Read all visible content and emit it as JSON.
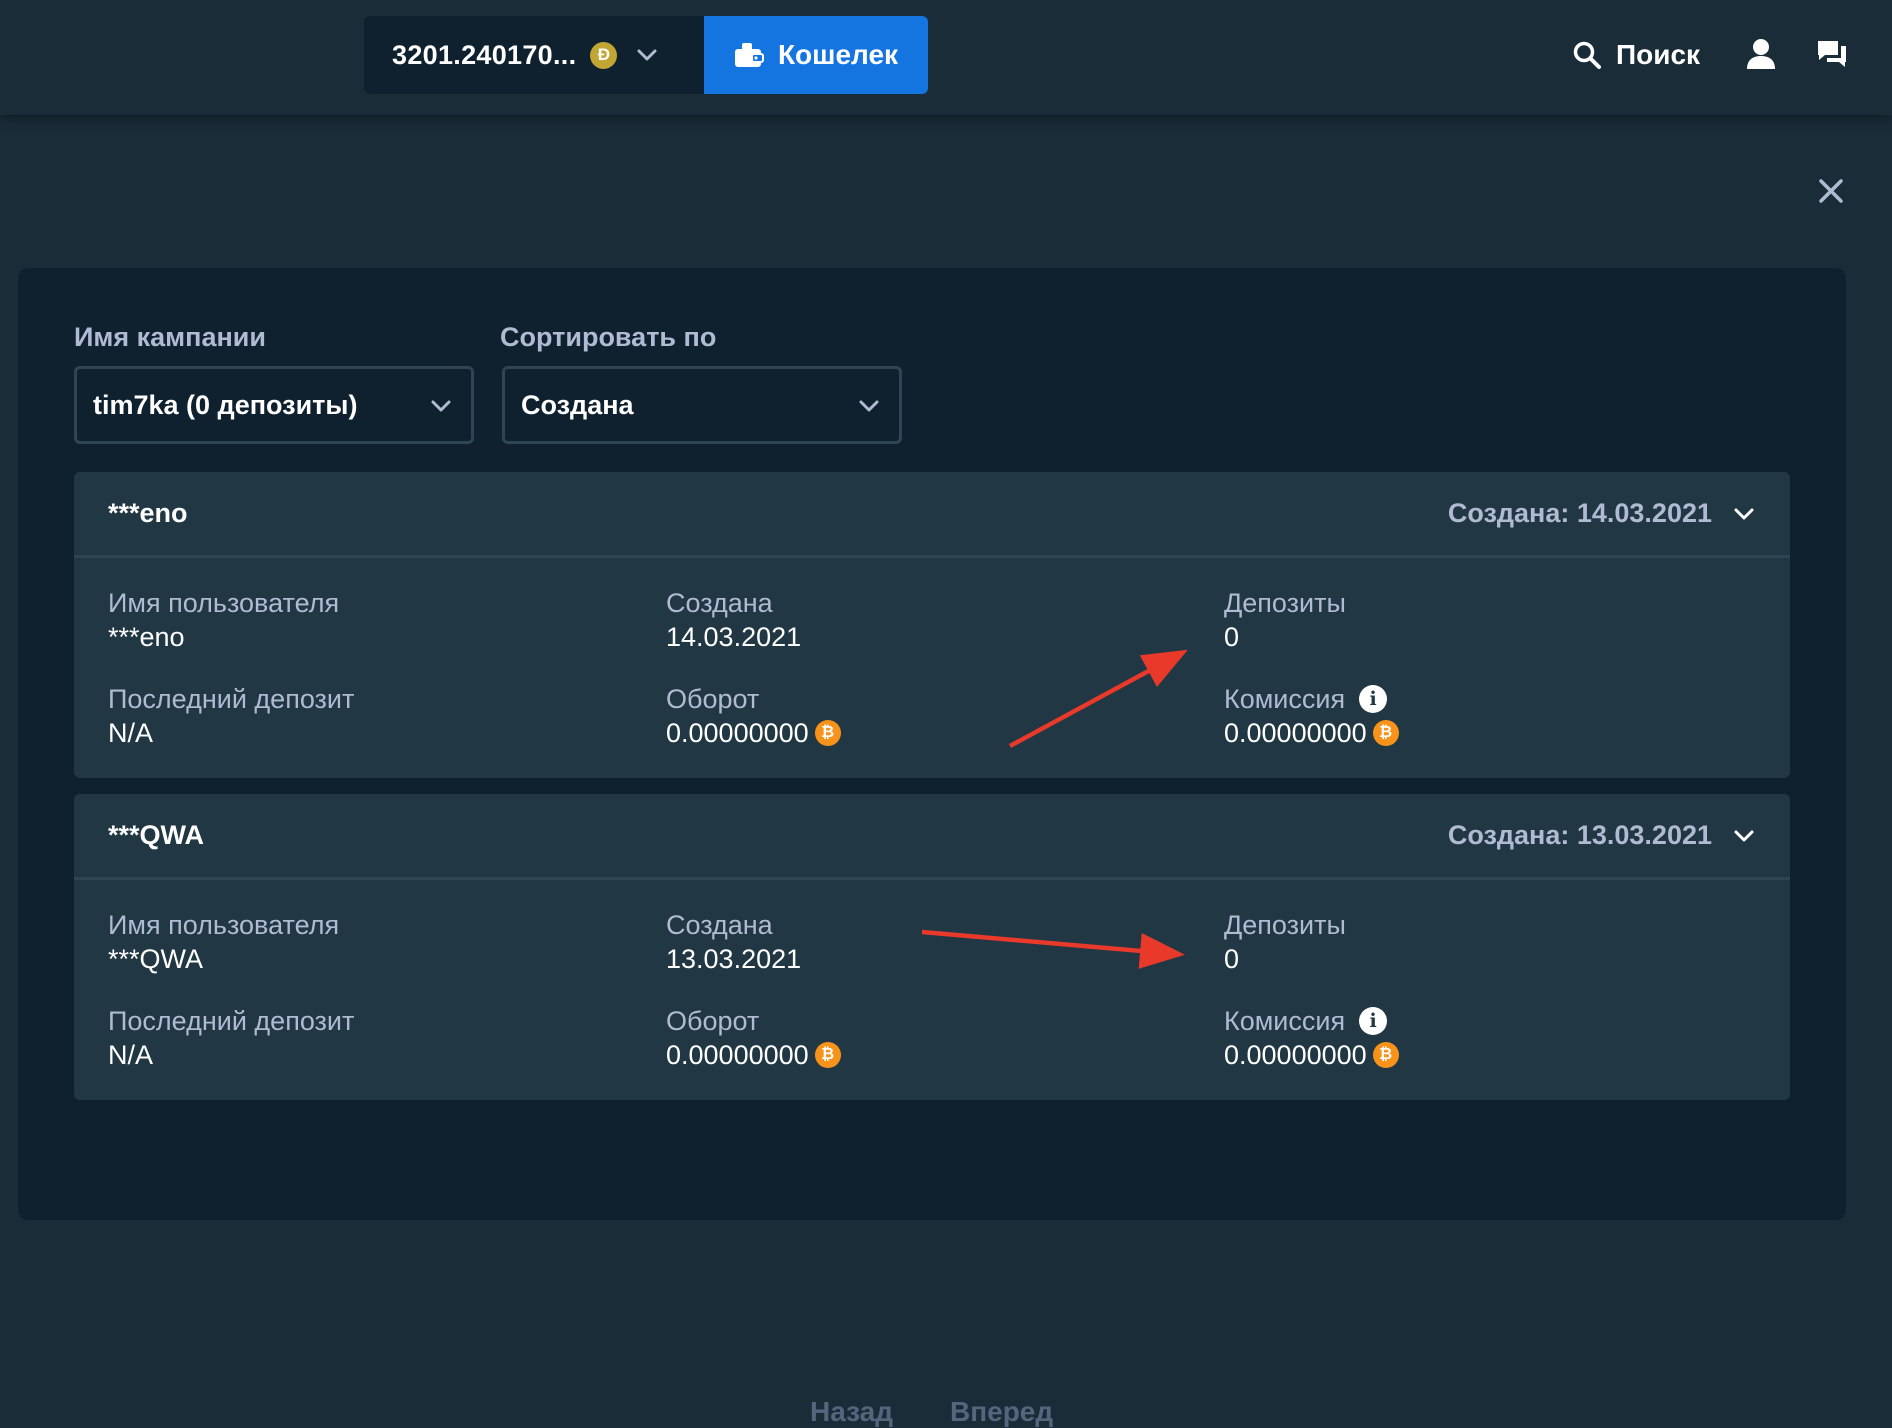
{
  "navbar": {
    "balance": "3201.240170...",
    "balance_currency_icon": "doge-coin-icon",
    "wallet_label": "Кошелек",
    "search_label": "Поиск"
  },
  "filters": {
    "campaign_label": "Имя кампании",
    "campaign_value": "tim7ka (0 депозиты)",
    "sort_label": "Сортировать по",
    "sort_value": "Создана"
  },
  "cards": [
    {
      "username_masked": "***eno",
      "created_header": "Создана: 14.03.2021",
      "fields": {
        "username_label": "Имя пользователя",
        "username_value": "***eno",
        "created_label": "Создана",
        "created_value": "14.03.2021",
        "deposits_label": "Депозиты",
        "deposits_value": "0",
        "last_deposit_label": "Последний депозит",
        "last_deposit_value": "N/A",
        "turnover_label": "Оборот",
        "turnover_value": "0.00000000",
        "commission_label": "Комиссия",
        "commission_value": "0.00000000"
      }
    },
    {
      "username_masked": "***QWA",
      "created_header": "Создана: 13.03.2021",
      "fields": {
        "username_label": "Имя пользователя",
        "username_value": "***QWA",
        "created_label": "Создана",
        "created_value": "13.03.2021",
        "deposits_label": "Депозиты",
        "deposits_value": "0",
        "last_deposit_label": "Последний депозит",
        "last_deposit_value": "N/A",
        "turnover_label": "Оборот",
        "turnover_value": "0.00000000",
        "commission_label": "Комиссия",
        "commission_value": "0.00000000"
      }
    }
  ],
  "pagination": {
    "prev_label": "Назад",
    "next_label": "Вперед"
  },
  "colors": {
    "background": "#1a2c38",
    "panel": "#0f212e",
    "card": "#213743",
    "accent_blue": "#1475e1",
    "annotation_red": "#e8392b",
    "btc_orange": "#f7931a"
  }
}
